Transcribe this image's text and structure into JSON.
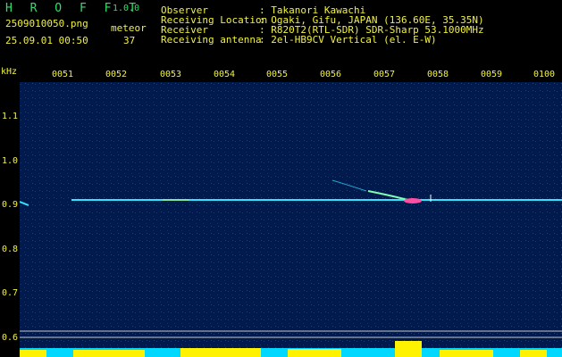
{
  "app": {
    "name": "H R O F F T",
    "version": "1.0.0"
  },
  "file": {
    "name": "2509010050.png",
    "datetime": "25.09.01 00:50"
  },
  "meteor": {
    "label": "meteor",
    "count": "37"
  },
  "info": [
    {
      "key": "Observer",
      "value": ": Takanori Kawachi"
    },
    {
      "key": "Receiving Location",
      "value": ": Ogaki, Gifu, JAPAN (136.60E, 35.35N)"
    },
    {
      "key": "Receiver",
      "value": ": R820T2(RTL-SDR) SDR-Sharp 53.1000MHz"
    },
    {
      "key": "Receiving antenna",
      "value": ": 2el-HB9CV Vertical (el. E-W)"
    }
  ],
  "axis": {
    "unit": "kHz",
    "time_ticks": [
      "0051",
      "0052",
      "0053",
      "0054",
      "0055",
      "0056",
      "0057",
      "0058",
      "0059",
      "0100"
    ],
    "freq_ticks": [
      "1.1",
      "1.0",
      "0.9",
      "0.8",
      "0.7",
      "0.6"
    ]
  },
  "colors": {
    "background": "#000000",
    "plot_bg": "#001a4e",
    "label_yellow": "#f2f23c",
    "title_green": "#2ee06a",
    "signal_cyan": "#35e3ff",
    "noise_yellow": "#fff200"
  }
}
